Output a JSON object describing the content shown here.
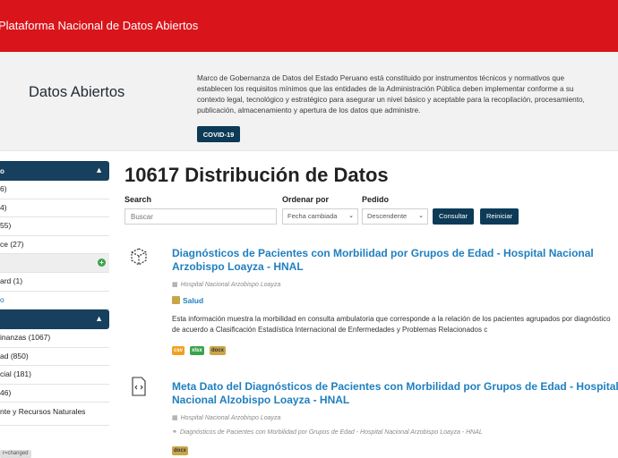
{
  "header": {
    "title": "Plataforma Nacional de Datos Abiertos"
  },
  "hero": {
    "title": "Datos Abiertos",
    "description": "Marco de Gobernanza de Datos del Estado Peruano está constituido por instrumentos técnicos y normativos que establecen los requisitos mínimos que las entidades de la Administración Pública deben implementar conforme a su contexto legal, tecnológico y estratégico para asegurar un nivel básico y aceptable para la recopilación, procesamiento, publicación, almacenamiento y apertura de los datos que administre.",
    "covid_button": "COVID-19"
  },
  "sidebar": {
    "section1_label": "o",
    "section1_items": [
      "6)",
      "4)",
      "55)",
      "ce (27)"
    ],
    "sub1_item": "ard (1)",
    "sub1_link": "o",
    "section2_items": [
      "inanzas (1067)",
      "ad (850)",
      "cial (181)",
      "46)",
      "nte y Recursos Naturales"
    ],
    "tag": "r=changed"
  },
  "main": {
    "title": "10617 Distribución de Datos",
    "filters": {
      "search_label": "Buscar",
      "search_placeholder": "Buscar",
      "search_heading": "Search",
      "order_label": "Ordenar por",
      "order_value": "Fecha cambiada",
      "order_dir_label": "Pedido",
      "order_dir_value": "Descendente",
      "submit": "Consultar",
      "reset": "Reiniciar"
    },
    "datasets": [
      {
        "title": "Diagnósticos de Pacientes con Morbilidad por Grupos de Edad - Hospital Nacional Arzobispo Loayza - HNAL",
        "org": "Hospital Nacional Arzobispo Loayza",
        "category": "Salud",
        "description": "Esta información muestra la morbilidad en consulta ambulatoria que corresponde a la relación de los pacientes agrupados por diagnóstico de acuerdo a Clasificación Estadística Internacional de Enfermedades y Problemas Relacionados c",
        "formats": [
          "csv",
          "xlsx",
          "docx"
        ]
      },
      {
        "title": "Meta Dato del Diagnósticos de Pacientes con Morbilidad por Grupos de Edad - Hospital Nacional Alzobispo Loayza - HNAL",
        "org": "Hospital Nacional Arzobispo Loayza",
        "related": "Diagnósticos de Pacientes con Morbilidad por Grupos de Edad - Hospital Nacional Arzobispo Loayza - HNAL",
        "formats": [
          "docx"
        ]
      }
    ]
  },
  "colors": {
    "brand_red": "#d9151b",
    "navy": "#0d3b57",
    "link_blue": "#1f7fbf"
  }
}
